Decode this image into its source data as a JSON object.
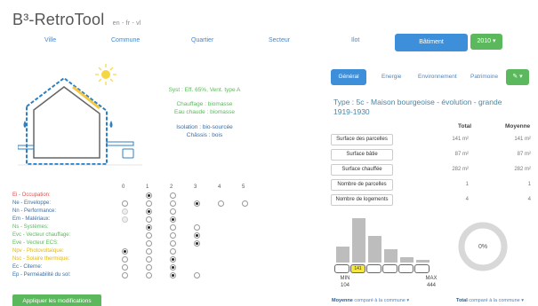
{
  "app": {
    "title": "B³-RetroTool",
    "languages": "en - fr - vl"
  },
  "nav": {
    "items": [
      "Ville",
      "Commune",
      "Quartier",
      "Secteur",
      "Ilot",
      "Bâtiment"
    ],
    "active": "Bâtiment",
    "year": "2010 ▾"
  },
  "house_info": {
    "syst": "Syst : Eff. 65%, Vent. type A",
    "chauffage": "Chauffage : biomasse",
    "eau_chaude": "Eau chaude : biomasse",
    "isolation": "Isolation : bio-sourcée",
    "chassis": "Châssis : bois"
  },
  "matrix": {
    "columns": [
      "0",
      "1",
      "2",
      "3",
      "4",
      "5"
    ],
    "rows": [
      {
        "label": "Ei - Occupation:",
        "color": "#d9534f"
      },
      {
        "label": "Ne - Enveloppe:",
        "color": "#3a6ea5"
      },
      {
        "label": "Nn - Performance:",
        "color": "#3a6ea5"
      },
      {
        "label": "Em - Matériaux:",
        "color": "#3a6ea5"
      },
      {
        "label": "Ns - Systèmes:",
        "color": "#5cb85c"
      },
      {
        "label": "Evc - Vecteur chauffage:",
        "color": "#5cb85c"
      },
      {
        "label": "Eve - Vecteur ECS:",
        "color": "#5cb85c"
      },
      {
        "label": "Npv - Photovoltaïque:",
        "color": "#e6b800"
      },
      {
        "label": "Nsc - Solaire thermique:",
        "color": "#e6b800"
      },
      {
        "label": "Ec - Citerne:",
        "color": "#3a6ea5"
      },
      {
        "label": "Ep - Perméabilité du sol:",
        "color": "#3a6ea5"
      }
    ]
  },
  "apply_button": "Appliquer les modifications",
  "tabs": {
    "items": [
      "Général",
      "Energie",
      "Environnement",
      "Patrimoine"
    ],
    "active": "Général",
    "edit": "✎ ▾"
  },
  "building": {
    "type_title": "Type : 5c - Maison bourgeoise - évolution - grande 1919-1930",
    "col_total": "Total",
    "col_avg": "Moyenne",
    "stats": [
      {
        "label": "Surface des parcelles",
        "total": "141 m²",
        "avg": "141 m²"
      },
      {
        "label": "Surface bâtie",
        "total": "87 m²",
        "avg": "87 m²"
      },
      {
        "label": "Surface chauffée",
        "total": "282 m²",
        "avg": "282 m²"
      },
      {
        "label": "Nombre de parcelles",
        "total": "1",
        "avg": "1"
      },
      {
        "label": "Nombre de logements",
        "total": "4",
        "avg": "4"
      }
    ]
  },
  "histogram": {
    "bins": [
      "",
      "141",
      "",
      "",
      "",
      ""
    ],
    "highlight_index": 1,
    "heights": [
      0.35,
      1.0,
      0.6,
      0.3,
      0.12,
      0.06
    ],
    "min_label": "MIN",
    "min_value": "104",
    "max_label": "MAX",
    "max_value": "444"
  },
  "donut": {
    "value": "0%",
    "fraction": 0
  },
  "footer": {
    "left_bold": "Moyenne",
    "left_text": "comparé à la commune ▾",
    "right_bold": "Total",
    "right_text": "comparé à la commune ▾"
  },
  "colors": {
    "accent_blue": "#3d8fd9",
    "green": "#5cb85c",
    "link": "#4a86c5"
  }
}
